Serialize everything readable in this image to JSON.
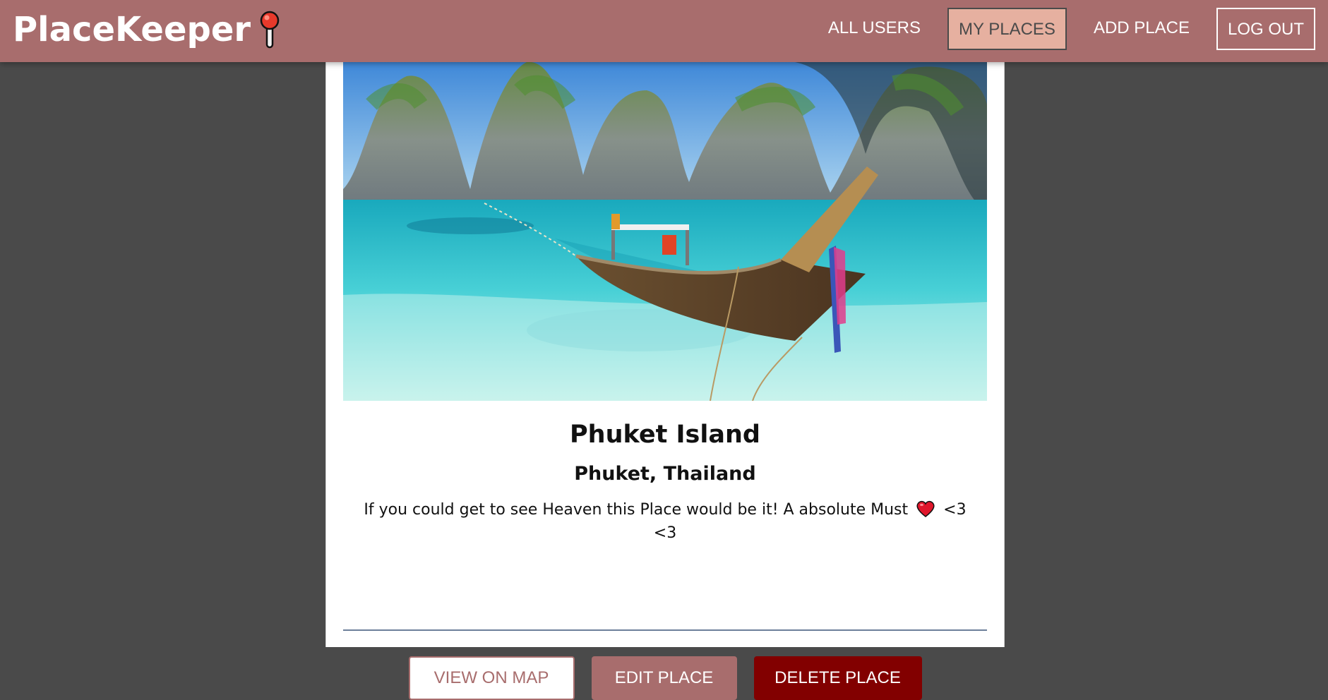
{
  "header": {
    "brand": "PlaceKeeper",
    "brand_icon": "map-pin-icon",
    "nav": {
      "all_users": "ALL USERS",
      "my_places": "MY PLACES",
      "add_place": "ADD PLACE",
      "log_out": "LOG OUT"
    },
    "active_nav": "MY PLACES"
  },
  "place": {
    "image_subject": "longtail boat on turquoise beach with limestone cliffs",
    "title": "Phuket Island",
    "address": "Phuket, Thailand",
    "description_before_icon": "If you could get to see Heaven this Place would be it! A absolute Must",
    "description_icon": "heart-icon",
    "description_after_icon": "<3 <3"
  },
  "actions": {
    "view_on_map": "VIEW ON MAP",
    "edit_place": "EDIT PLACE",
    "delete_place": "DELETE PLACE"
  },
  "colors": {
    "header_bg": "#a86d6d",
    "active_nav_bg": "#e6b0a0",
    "page_bg": "#4a4a4a",
    "delete_bg": "#820000",
    "divider": "#6c7f9a"
  }
}
